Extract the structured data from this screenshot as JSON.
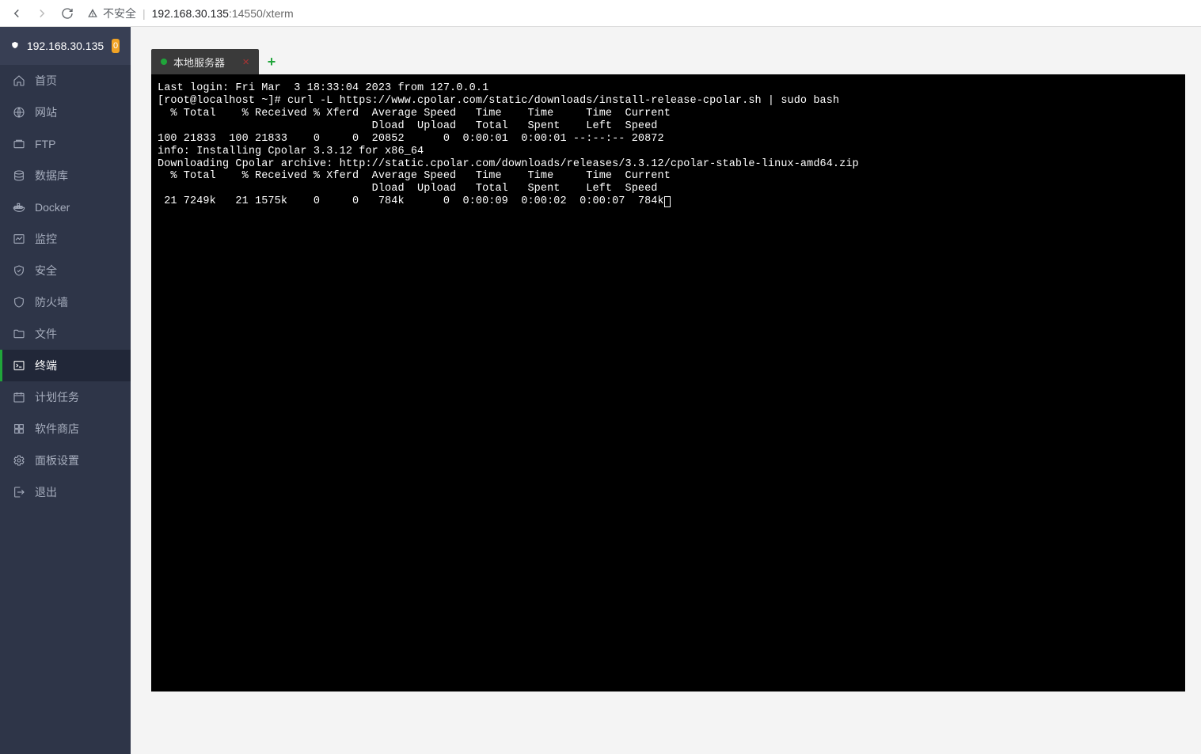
{
  "browser": {
    "insecure_label": "不安全",
    "url_host": "192.168.30.135",
    "url_port": ":14550",
    "url_path": "/xterm"
  },
  "sidebar": {
    "title": "192.168.30.135",
    "badge": "0",
    "items": [
      {
        "key": "home",
        "label": "首页"
      },
      {
        "key": "site",
        "label": "网站"
      },
      {
        "key": "ftp",
        "label": "FTP"
      },
      {
        "key": "db",
        "label": "数据库"
      },
      {
        "key": "docker",
        "label": "Docker"
      },
      {
        "key": "monitor",
        "label": "监控"
      },
      {
        "key": "sec",
        "label": "安全"
      },
      {
        "key": "firewall",
        "label": "防火墙"
      },
      {
        "key": "files",
        "label": "文件"
      },
      {
        "key": "terminal",
        "label": "终端"
      },
      {
        "key": "cron",
        "label": "计划任务"
      },
      {
        "key": "store",
        "label": "软件商店"
      },
      {
        "key": "settings",
        "label": "面板设置"
      },
      {
        "key": "logout",
        "label": "退出"
      }
    ]
  },
  "tabs": {
    "active_label": "本地服务器"
  },
  "terminal_lines": [
    "Last login: Fri Mar  3 18:33:04 2023 from 127.0.0.1",
    "[root@localhost ~]# curl -L https://www.cpolar.com/static/downloads/install-release-cpolar.sh | sudo bash",
    "  % Total    % Received % Xferd  Average Speed   Time    Time     Time  Current",
    "                                 Dload  Upload   Total   Spent    Left  Speed",
    "100 21833  100 21833    0     0  20852      0  0:00:01  0:00:01 --:--:-- 20872",
    "info: Installing Cpolar 3.3.12 for x86_64",
    "Downloading Cpolar archive: http://static.cpolar.com/downloads/releases/3.3.12/cpolar-stable-linux-amd64.zip",
    "  % Total    % Received % Xferd  Average Speed   Time    Time     Time  Current",
    "                                 Dload  Upload   Total   Spent    Left  Speed",
    " 21 7249k   21 1575k    0     0   784k      0  0:00:09  0:00:02  0:00:07  784k"
  ]
}
